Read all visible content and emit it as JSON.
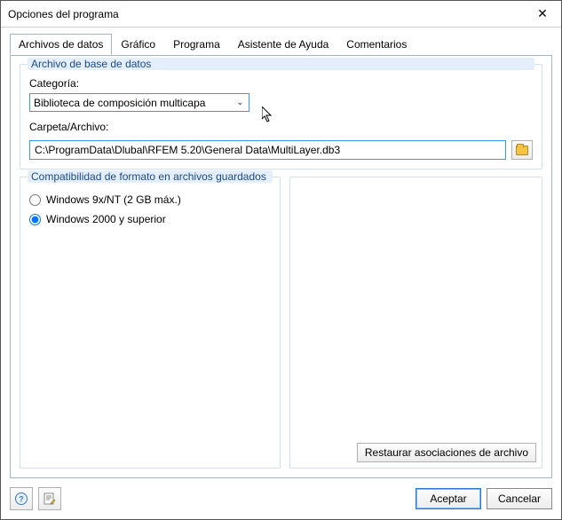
{
  "window": {
    "title": "Opciones del programa"
  },
  "tabs": {
    "t0": "Archivos de datos",
    "t1": "Gráfico",
    "t2": "Programa",
    "t3": "Asistente de Ayuda",
    "t4": "Comentarios"
  },
  "group_db": {
    "title": "Archivo de base de datos",
    "category_label": "Categoría:",
    "category_value": "Biblioteca de composición multicapa",
    "path_label": "Carpeta/Archivo:",
    "path_value": "C:\\ProgramData\\Dlubal\\RFEM 5.20\\General Data\\MultiLayer.db3"
  },
  "group_compat": {
    "title": "Compatibilidad de formato en archivos guardados",
    "opt1": "Windows 9x/NT (2 GB máx.)",
    "opt2": "Windows 2000 y superior",
    "selected": "opt2"
  },
  "buttons": {
    "restore": "Restaurar asociaciones de archivo",
    "ok": "Aceptar",
    "cancel": "Cancelar"
  },
  "icons": {
    "help": "?",
    "edit": "✎",
    "close": "✕",
    "dropdown": "⌄"
  }
}
